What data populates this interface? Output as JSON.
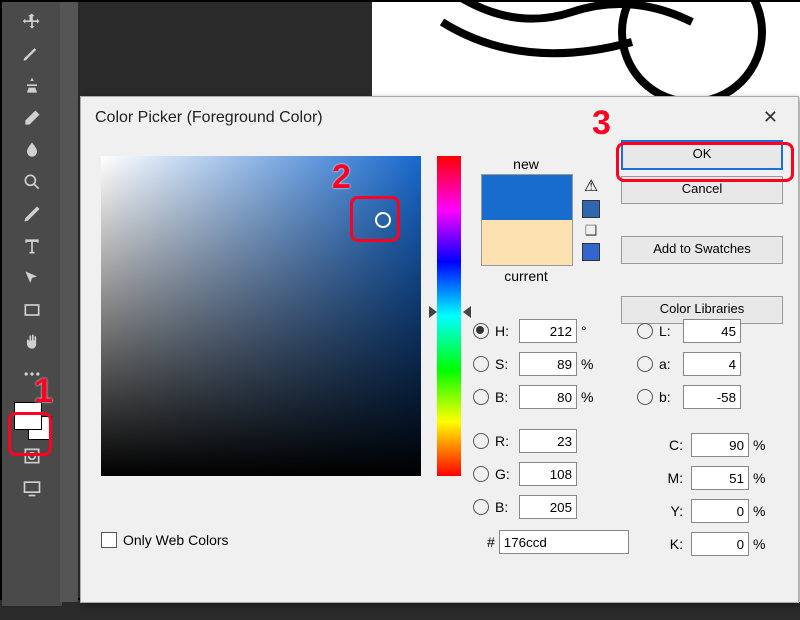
{
  "dialog": {
    "title": "Color Picker (Foreground Color)",
    "buttons": {
      "ok": "OK",
      "cancel": "Cancel",
      "add_swatches": "Add to Swatches",
      "color_libraries": "Color Libraries"
    },
    "preview": {
      "new_label": "new",
      "current_label": "current",
      "new_color": "#176ccd",
      "current_color": "#fbe2b0"
    },
    "hsb": {
      "H": {
        "label": "H:",
        "value": "212",
        "unit": "°",
        "checked": true
      },
      "S": {
        "label": "S:",
        "value": "89",
        "unit": "%",
        "checked": false
      },
      "B": {
        "label": "B:",
        "value": "80",
        "unit": "%",
        "checked": false
      }
    },
    "rgb": {
      "R": {
        "label": "R:",
        "value": "23",
        "checked": false
      },
      "G": {
        "label": "G:",
        "value": "108",
        "checked": false
      },
      "B": {
        "label": "B:",
        "value": "205",
        "checked": false
      }
    },
    "lab": {
      "L": {
        "label": "L:",
        "value": "45",
        "checked": false
      },
      "a": {
        "label": "a:",
        "value": "4",
        "checked": false
      },
      "b": {
        "label": "b:",
        "value": "-58",
        "checked": false
      }
    },
    "cmyk": {
      "C": {
        "label": "C:",
        "value": "90",
        "unit": "%"
      },
      "M": {
        "label": "M:",
        "value": "51",
        "unit": "%"
      },
      "Y": {
        "label": "Y:",
        "value": "0",
        "unit": "%"
      },
      "K": {
        "label": "K:",
        "value": "0",
        "unit": "%"
      }
    },
    "hex": {
      "prefix": "#",
      "value": "176ccd"
    },
    "only_web_colors": "Only Web Colors"
  },
  "annotations": {
    "1": "1",
    "2": "2",
    "3": "3"
  }
}
